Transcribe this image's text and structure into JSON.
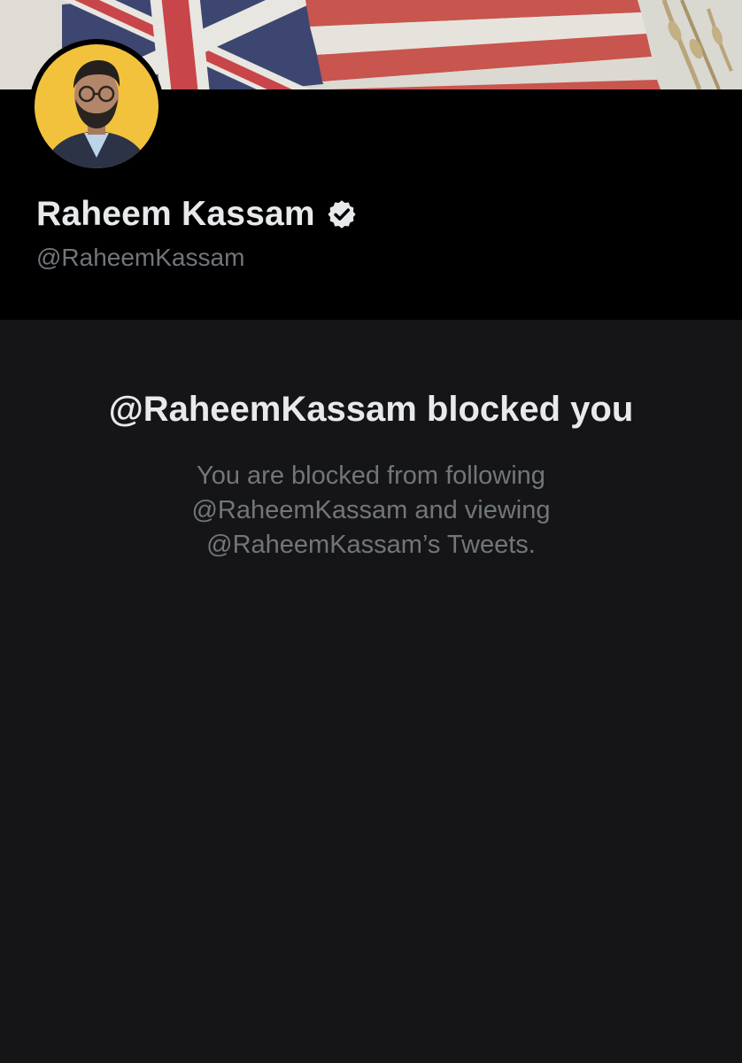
{
  "profile": {
    "display_name": "Raheem Kassam",
    "handle": "@RaheemKassam",
    "verified": true,
    "avatar_icon": "profile-photo",
    "banner_icon": "flag-banner-image"
  },
  "blocked_notice": {
    "title": "@RaheemKassam blocked you",
    "description_lines": [
      "You are blocked from following",
      "@RaheemKassam and viewing",
      "@RaheemKassam’s Tweets."
    ]
  },
  "colors": {
    "header_background": "#000000",
    "panel_background": "#151517",
    "primary_text": "#e7e9ea",
    "secondary_text": "#71767b",
    "avatar_background": "#f2c23d"
  }
}
